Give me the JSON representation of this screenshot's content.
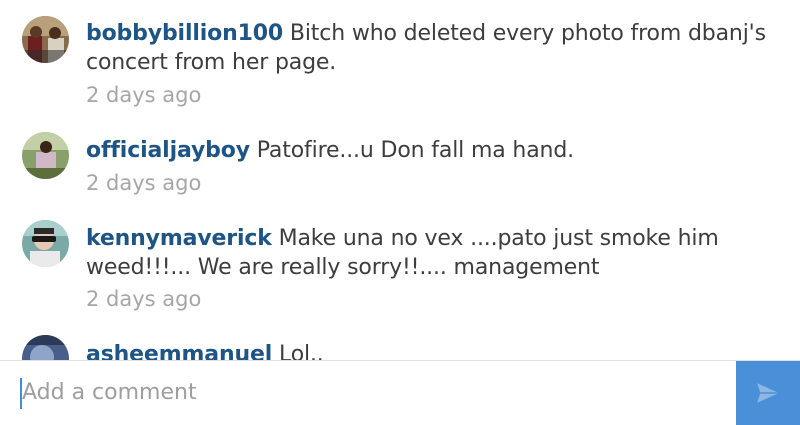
{
  "comments": [
    {
      "username": "bobbybillion100",
      "text": "Bitch who deleted every photo from dbanj's concert from her page.",
      "time": "2 days ago"
    },
    {
      "username": "officialjayboy",
      "text": "Patofire...u Don fall ma hand.",
      "time": "2 days ago"
    },
    {
      "username": "kennymaverick",
      "text": "Make una no vex ....pato just smoke him weed!!!... We are really sorry!!.... management",
      "time": "2 days ago"
    },
    {
      "username": "asheemmanuel",
      "text": "Lol..",
      "time": ""
    }
  ],
  "composer": {
    "placeholder": "Add a comment",
    "send_icon": "send-icon"
  },
  "colors": {
    "username": "#1f5584",
    "text": "#3d3d3d",
    "timestamp": "#a6a6a6",
    "send_button": "#4a90d9"
  }
}
